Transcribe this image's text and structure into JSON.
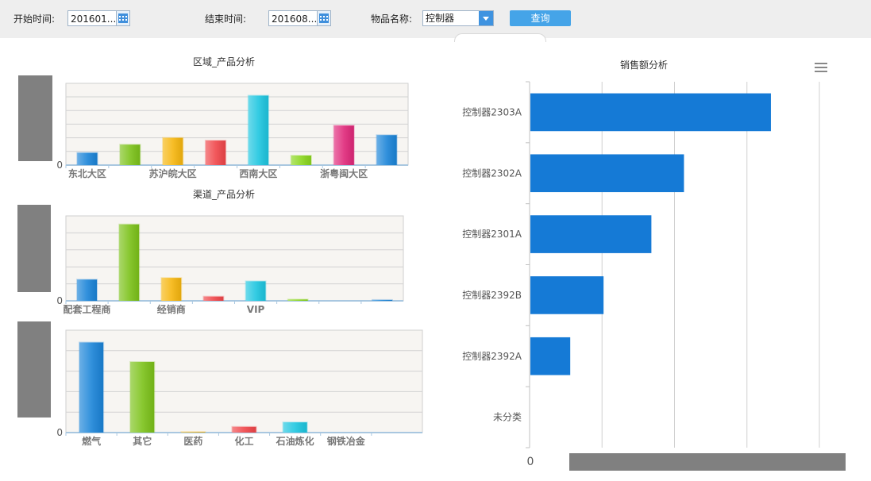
{
  "filters": {
    "start_label": "开始时间:",
    "start_value": "201601...",
    "end_label": "结束时间:",
    "end_value": "201608...",
    "item_label": "物品名称:",
    "item_value": "控制器",
    "query_label": "查询"
  },
  "chart_data": [
    {
      "type": "bar",
      "title": "区域_产品分析",
      "categories": [
        "东北大区",
        "",
        "苏沪皖大区",
        "",
        "西南大区",
        "",
        "浙粤闽大区",
        ""
      ],
      "values": [
        90,
        150,
        200,
        180,
        510,
        70,
        290,
        220
      ],
      "ylim": [
        0,
        600
      ],
      "colors": [
        "#1b84d8",
        "#7cc21a",
        "#f6b60f",
        "#f0464a",
        "#1ec6e0",
        "#8ad61e",
        "#e0287a",
        "#1b84d8"
      ]
    },
    {
      "type": "bar",
      "title": "渠道_产品分析",
      "categories": [
        "配套工程商",
        "",
        "经销商",
        "",
        "VIP",
        "",
        "",
        ""
      ],
      "values": [
        125,
        450,
        135,
        25,
        115,
        8,
        0,
        5
      ],
      "ylim": [
        0,
        500
      ],
      "colors": [
        "#1b84d8",
        "#7cc21a",
        "#f6b60f",
        "#f0464a",
        "#1ec6e0",
        "#8ad61e",
        "#e0287a",
        "#1b84d8"
      ]
    },
    {
      "type": "bar",
      "title": "",
      "categories": [
        "燃气",
        "其它",
        "医药",
        "化工",
        "石油炼化",
        "钢铁冶金",
        ""
      ],
      "values": [
        440,
        345,
        3,
        28,
        50,
        0,
        0
      ],
      "ylim": [
        0,
        500
      ],
      "colors": [
        "#1b84d8",
        "#7cc21a",
        "#f6b60f",
        "#f0464a",
        "#1ec6e0",
        "#8ad61e",
        "#1b84d8"
      ]
    },
    {
      "type": "bar",
      "orientation": "horizontal",
      "title": "销售额分析",
      "categories": [
        "控制器2303A",
        "控制器2302A",
        "控制器2301A",
        "控制器2392B",
        "控制器2392A",
        "未分类"
      ],
      "values": [
        3320,
        2120,
        1670,
        1010,
        550,
        0
      ],
      "xlim": [
        0,
        4000
      ],
      "x_tick_label": "0",
      "grid": true,
      "bar_color": "#157ad6"
    }
  ]
}
